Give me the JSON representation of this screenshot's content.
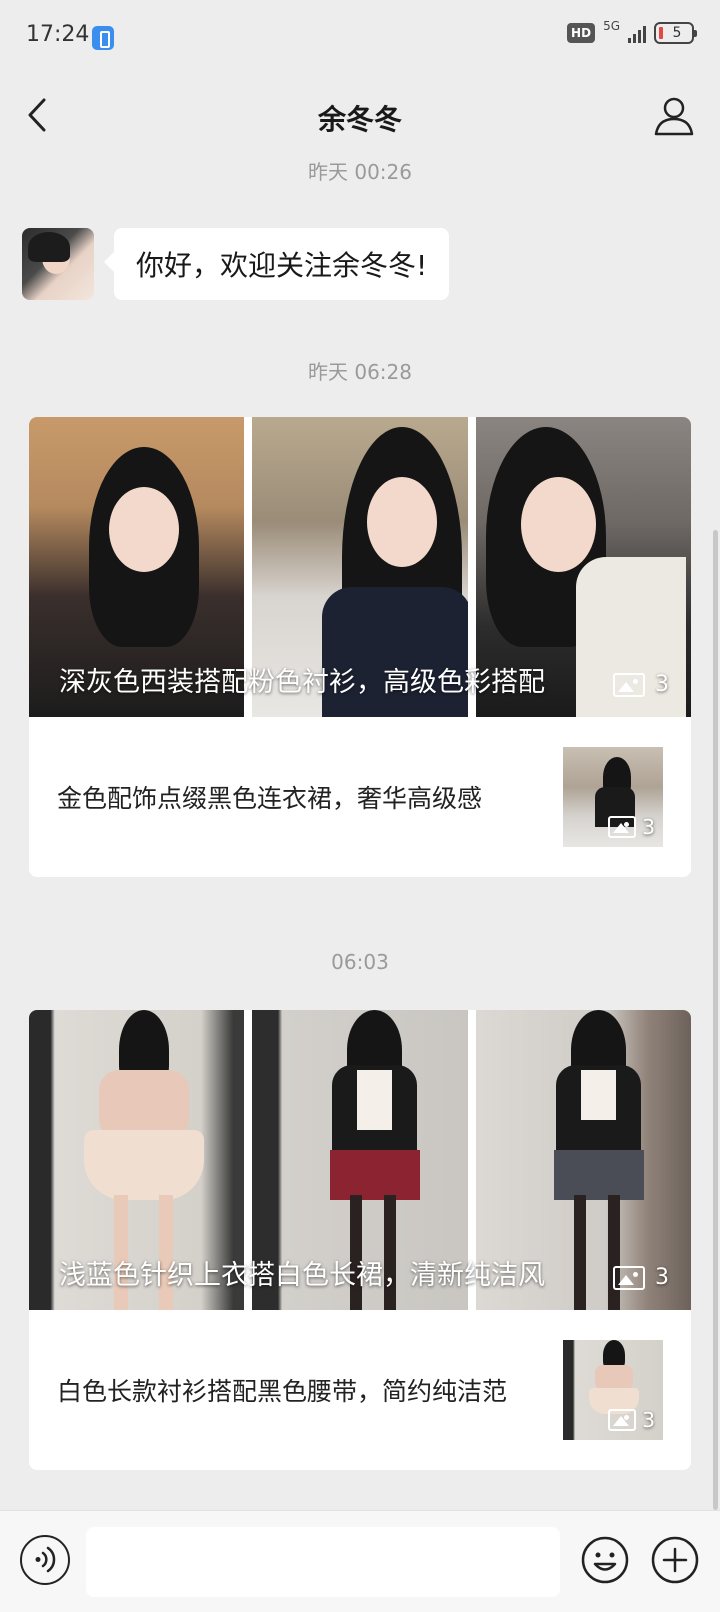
{
  "status_bar": {
    "time": "17:24",
    "hd_label": "HD",
    "network_label": "5G",
    "battery_level": "5"
  },
  "header": {
    "title": "余冬冬"
  },
  "messages": {
    "ts1": "昨天 00:26",
    "welcome_text": "你好，欢迎关注余冬冬!",
    "ts2": "昨天 06:28",
    "ts3": "06:03"
  },
  "article_groups": [
    {
      "cover_title": "深灰色西装搭配粉色衬衫，高级色彩搭配",
      "cover_count": "3",
      "sub_title": "金色配饰点缀黑色连衣裙，奢华高级感",
      "sub_count": "3"
    },
    {
      "cover_title": "浅蓝色针织上衣搭白色长裙，清新纯洁风",
      "cover_count": "3",
      "sub_title": "白色长款衬衫搭配黑色腰带，简约纯洁范",
      "sub_count": "3"
    }
  ],
  "input": {
    "placeholder": ""
  },
  "colors": {
    "background": "#ededed",
    "bubble": "#ffffff",
    "timestamp": "#9a9a9a",
    "battery_low": "#e5483f"
  }
}
